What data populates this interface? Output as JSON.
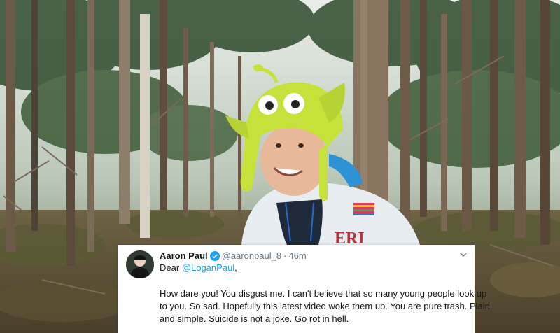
{
  "tweet": {
    "author_name": "Aaron Paul",
    "handle": "@aaronpaul_8",
    "separator": "·",
    "time": "46m",
    "greeting_prefix": "Dear ",
    "mention": "@LoganPaul",
    "greeting_suffix": ",",
    "body_lines": [
      "How dare you! You disgust me. I can't believe that so many young people look up",
      "to you. So sad. Hopefully this latest video woke them up. You are pure trash. Plain",
      "and simple. Suicide is not a joke. Go rot in hell."
    ]
  },
  "icons": {
    "verified": "verified-badge-icon",
    "menu": "chevron-down-icon",
    "avatar": "avatar"
  },
  "colors": {
    "mention": "#1da1f2",
    "verified": "#1da1f2",
    "text": "#14171a",
    "secondary": "#657786",
    "costume_hat": "#c6e23a",
    "hoodie": "#e8edf1",
    "forest": "#3c4a2f"
  }
}
